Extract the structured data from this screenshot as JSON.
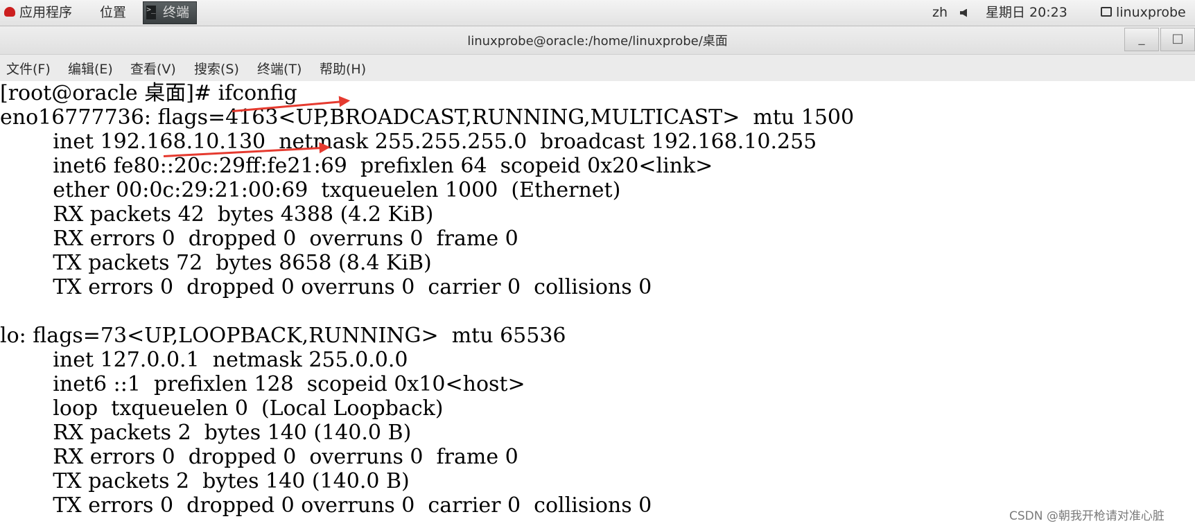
{
  "topbar": {
    "applications": "应用程序",
    "places": "位置",
    "task_terminal": "终端",
    "input_method": "zh",
    "clock": "星期日 20:23",
    "user": "linuxprobe",
    "icons": [
      "redhat-icon",
      "terminal-icon",
      "sound-icon",
      "user-icon"
    ]
  },
  "window": {
    "title": "linuxprobe@oracle:/home/linuxprobe/桌面",
    "minimize": "_",
    "maximize": "□",
    "close": "×"
  },
  "menubar": {
    "items": [
      "文件(F)",
      "编辑(E)",
      "查看(V)",
      "搜索(S)",
      "终端(T)",
      "帮助(H)"
    ]
  },
  "terminal": {
    "lines": [
      "[root@oracle 桌面]# ifconfig",
      "eno16777736: flags=4163<UP,BROADCAST,RUNNING,MULTICAST>  mtu 1500",
      "        inet 192.168.10.130  netmask 255.255.255.0  broadcast 192.168.10.255",
      "        inet6 fe80::20c:29ff:fe21:69  prefixlen 64  scopeid 0x20<link>",
      "        ether 00:0c:29:21:00:69  txqueuelen 1000  (Ethernet)",
      "        RX packets 42  bytes 4388 (4.2 KiB)",
      "        RX errors 0  dropped 0  overruns 0  frame 0",
      "        TX packets 72  bytes 8658 (8.4 KiB)",
      "        TX errors 0  dropped 0 overruns 0  carrier 0  collisions 0",
      "",
      "lo: flags=73<UP,LOOPBACK,RUNNING>  mtu 65536",
      "        inet 127.0.0.1  netmask 255.0.0.0",
      "        inet6 ::1  prefixlen 128  scopeid 0x10<host>",
      "        loop  txqueuelen 0  (Local Loopback)",
      "        RX packets 2  bytes 140 (140.0 B)",
      "        RX errors 0  dropped 0  overruns 0  frame 0",
      "        TX packets 2  bytes 140 (140.0 B)",
      "        TX errors 0  dropped 0 overruns 0  carrier 0  collisions 0"
    ]
  },
  "annotation": {
    "arrow_color": "#e53a2f"
  },
  "watermark": "CSDN @朝我开枪请对准心脏"
}
